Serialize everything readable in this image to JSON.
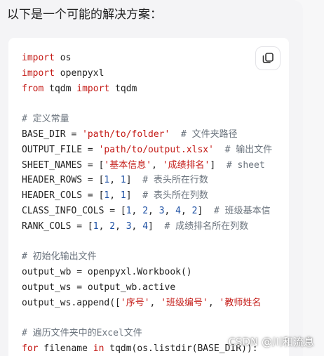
{
  "message": {
    "intro": "以下是一个可能的解决方案："
  },
  "code_block": {
    "lines": [
      [
        {
          "t": "import",
          "c": "kw"
        },
        {
          "t": " os"
        }
      ],
      [
        {
          "t": "import",
          "c": "kw"
        },
        {
          "t": " openpyxl"
        }
      ],
      [
        {
          "t": "from",
          "c": "kw"
        },
        {
          "t": " tqdm "
        },
        {
          "t": "import",
          "c": "kw"
        },
        {
          "t": " tqdm"
        }
      ],
      [
        {
          "t": ""
        }
      ],
      [
        {
          "t": "# 定义常量",
          "c": "cm"
        }
      ],
      [
        {
          "t": "BASE_DIR = "
        },
        {
          "t": "'path/to/folder'",
          "c": "str"
        },
        {
          "t": "  "
        },
        {
          "t": "# 文件夹路径",
          "c": "cm"
        }
      ],
      [
        {
          "t": "OUTPUT_FILE = "
        },
        {
          "t": "'path/to/output.xlsx'",
          "c": "str"
        },
        {
          "t": "  "
        },
        {
          "t": "# 输出文件",
          "c": "cm"
        }
      ],
      [
        {
          "t": "SHEET_NAMES = ["
        },
        {
          "t": "'基本信息'",
          "c": "str"
        },
        {
          "t": ", "
        },
        {
          "t": "'成绩排名'",
          "c": "str"
        },
        {
          "t": "]  "
        },
        {
          "t": "# sheet",
          "c": "cm"
        }
      ],
      [
        {
          "t": "HEADER_ROWS = ["
        },
        {
          "t": "1",
          "c": "num"
        },
        {
          "t": ", "
        },
        {
          "t": "1",
          "c": "num"
        },
        {
          "t": "]  "
        },
        {
          "t": "# 表头所在行数",
          "c": "cm"
        }
      ],
      [
        {
          "t": "HEADER_COLS = ["
        },
        {
          "t": "1",
          "c": "num"
        },
        {
          "t": ", "
        },
        {
          "t": "1",
          "c": "num"
        },
        {
          "t": "]  "
        },
        {
          "t": "# 表头所在列数",
          "c": "cm"
        }
      ],
      [
        {
          "t": "CLASS_INFO_COLS = ["
        },
        {
          "t": "1",
          "c": "num"
        },
        {
          "t": ", "
        },
        {
          "t": "2",
          "c": "num"
        },
        {
          "t": ", "
        },
        {
          "t": "3",
          "c": "num"
        },
        {
          "t": ", "
        },
        {
          "t": "4",
          "c": "num"
        },
        {
          "t": ", "
        },
        {
          "t": "2",
          "c": "num"
        },
        {
          "t": "]  "
        },
        {
          "t": "# 班级基本信",
          "c": "cm"
        }
      ],
      [
        {
          "t": "RANK_COLS = ["
        },
        {
          "t": "1",
          "c": "num"
        },
        {
          "t": ", "
        },
        {
          "t": "2",
          "c": "num"
        },
        {
          "t": ", "
        },
        {
          "t": "3",
          "c": "num"
        },
        {
          "t": ", "
        },
        {
          "t": "4",
          "c": "num"
        },
        {
          "t": "]  "
        },
        {
          "t": "# 成绩排名所在列数",
          "c": "cm"
        }
      ],
      [
        {
          "t": ""
        }
      ],
      [
        {
          "t": "# 初始化输出文件",
          "c": "cm"
        }
      ],
      [
        {
          "t": "output_wb = openpyxl.Workbook()"
        }
      ],
      [
        {
          "t": "output_ws = output_wb.active"
        }
      ],
      [
        {
          "t": "output_ws.append(["
        },
        {
          "t": "'序号'",
          "c": "str"
        },
        {
          "t": ", "
        },
        {
          "t": "'班级编号'",
          "c": "str"
        },
        {
          "t": ", "
        },
        {
          "t": "'教师姓名",
          "c": "str"
        }
      ],
      [
        {
          "t": ""
        }
      ],
      [
        {
          "t": "# 遍历文件夹中的Excel文件",
          "c": "cm"
        }
      ],
      [
        {
          "t": "for",
          "c": "kw"
        },
        {
          "t": " filename "
        },
        {
          "t": "in",
          "c": "kw"
        },
        {
          "t": " tqdm(os.listdir(BASE_DIR)):"
        }
      ]
    ]
  },
  "copy_button": {
    "icon": "copy-icon"
  },
  "watermark": {
    "text": "CSDN @川和流息"
  },
  "colors": {
    "keyword": "#c41a16",
    "string": "#c41a16",
    "number": "#1c4fa3",
    "comment": "#6a737d"
  }
}
